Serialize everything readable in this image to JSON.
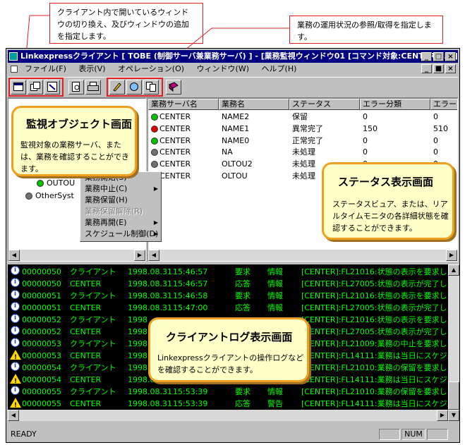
{
  "callouts": {
    "left_text": "クライアント内で開いているウィンドウの切り換え、及びウィンドウの追加を指定します。",
    "right_text": "業務の運用状況の参照/取得を指定します。"
  },
  "window": {
    "title": "Linkexpressクライアント [ TOBE (制御サーバ兼業務サーバ) ] - [業務監視ウィンドウ01 [コマンド対象:CENTER:NA]]",
    "controls": [
      "_",
      "□",
      "×"
    ],
    "mdi_controls": [
      "_",
      "■",
      "×"
    ]
  },
  "menu": [
    "ファイル(F)",
    "表示(V)",
    "オペレーション(O)",
    "ウィンドウ(W)",
    "ヘルプ(H)"
  ],
  "toolbar_icons": [
    "window-icon",
    "tile-icon",
    "monitor-icon",
    "preview-icon",
    "print-icon",
    "operation-icon",
    "refresh-icon",
    "copy-icon",
    "book-icon"
  ],
  "tree": {
    "items": [
      "OUTOU",
      "OtherSyst"
    ]
  },
  "context_menu": {
    "items": [
      {
        "label": "業務開始(S)",
        "enabled": true,
        "submenu": false
      },
      {
        "label": "業務中止(C)",
        "enabled": true,
        "submenu": true
      },
      {
        "label": "業務保留(H)",
        "enabled": true,
        "submenu": false
      },
      {
        "label": "業務保留解除(R)",
        "enabled": false,
        "submenu": false
      },
      {
        "label": "業務再開(E)",
        "enabled": true,
        "submenu": true
      },
      {
        "label": "スケジュール制御(D)",
        "enabled": true,
        "submenu": true
      }
    ]
  },
  "status_view": {
    "columns": [
      "業務サーバ名",
      "業務名",
      "ステータス",
      "エラー分類",
      "エラーコー"
    ],
    "rows": [
      {
        "server": "CENTER",
        "job": "NAME2",
        "status": "保留",
        "err_class": "0",
        "err_code": "0",
        "color": "#00c000"
      },
      {
        "server": "CENTER",
        "job": "NAME1",
        "status": "異常完了",
        "err_class": "150",
        "err_code": "510",
        "color": "#e00000"
      },
      {
        "server": "CENTER",
        "job": "NAME0",
        "status": "正常完了",
        "err_class": "0",
        "err_code": "0",
        "color": "#00c000"
      },
      {
        "server": "CENTER",
        "job": "NA",
        "status": "未処理",
        "err_class": "0",
        "err_code": "0",
        "color": "#707070"
      },
      {
        "server": "CENTER",
        "job": "OLTOU2",
        "status": "未処理",
        "err_class": "0",
        "err_code": "0",
        "color": "#707070"
      },
      {
        "server": "CENTER",
        "job": "OLTOU",
        "status": "未処理",
        "err_class": "0",
        "err_code": "0",
        "color": "#707070"
      }
    ]
  },
  "log": {
    "rows": [
      {
        "icon": "info",
        "id": "00000050",
        "src": "クライアント",
        "date": "1998.08.31",
        "time": "15:46:57",
        "kind": "要求",
        "level": "情報",
        "msg": "[CENTER]:FL21016:状態の表示を要求しま"
      },
      {
        "icon": "info",
        "id": "00000050",
        "src": "CENTER",
        "date": "1998.08.31",
        "time": "15:46:57",
        "kind": "応答",
        "level": "情報",
        "msg": "[CENTER]:FL27005:状態の表示が完了しま"
      },
      {
        "icon": "info",
        "id": "00000051",
        "src": "クライアント",
        "date": "1998.08.31",
        "time": "15:46:58",
        "kind": "要求",
        "level": "情報",
        "msg": "[CENTER]:FL21016:状態の表示を要求しま"
      },
      {
        "icon": "info",
        "id": "00000051",
        "src": "CENTER",
        "date": "1998.08.31",
        "time": "15:47:00",
        "kind": "応答",
        "level": "情報",
        "msg": "[CENTER]:FL27005:状態の表示が完了しま"
      },
      {
        "icon": "info",
        "id": "00000052",
        "src": "クライアント",
        "date": "1998",
        "time": "",
        "kind": "",
        "level": "",
        "msg": "[CENTER]:FL21016:状態の表示を要求しま"
      },
      {
        "icon": "info",
        "id": "00000052",
        "src": "CENTER",
        "date": "1998",
        "time": "",
        "kind": "",
        "level": "",
        "msg": "[CENTER]:FL27005:状態の表示が完了しま"
      },
      {
        "icon": "info",
        "id": "00000053",
        "src": "クライアント",
        "date": "1998",
        "time": "",
        "kind": "",
        "level": "",
        "msg": "[CENTER]:FL21009:業務の中止を要求しま"
      },
      {
        "icon": "warn",
        "id": "00000053",
        "src": "CENTER",
        "date": "1998",
        "time": "",
        "kind": "",
        "level": "",
        "msg": "[CENTER]:FL14111:業務は当日にスケジュ"
      },
      {
        "icon": "info",
        "id": "00000054",
        "src": "クライアント",
        "date": "1998",
        "time": "",
        "kind": "",
        "level": "",
        "msg": "[CENTER]:FL21010:業務の保留を要求しま"
      },
      {
        "icon": "warn",
        "id": "00000054",
        "src": "CENTER",
        "date": "1998.08.31",
        "time": "15:53:38",
        "kind": "応答",
        "level": "警告",
        "msg": "[CENTER]:FL14111:業務は当日にスケジュ"
      },
      {
        "icon": "info",
        "id": "00000055",
        "src": "クライアント",
        "date": "1998.08.31",
        "time": "15:53:39",
        "kind": "要求",
        "level": "情報",
        "msg": "[CENTER]:FL21010:業務の保留を要求しま"
      },
      {
        "icon": "warn",
        "id": "00000055",
        "src": "CENTER",
        "date": "1998.08.31",
        "time": "15:53:39",
        "kind": "応答",
        "level": "警告",
        "msg": "[CENTER]:FL14111:業務は当日にスケジュ"
      }
    ]
  },
  "bubbles": {
    "monitor": {
      "title": "監視オブジェクト画面",
      "body": "監視対象の業務サーバ、または、業務を確認することができます。"
    },
    "status": {
      "title": "ステータス表示画面",
      "body": "ステータスビュア、または、リアルタイムモニタの各詳細状態を確認することができます。"
    },
    "log": {
      "title": "クライアントログ表示画面",
      "body": "Linkexpressクライアントの操作ログなどを確認することができます。"
    }
  },
  "statusbar": {
    "ready": "READY",
    "num": "NUM"
  }
}
